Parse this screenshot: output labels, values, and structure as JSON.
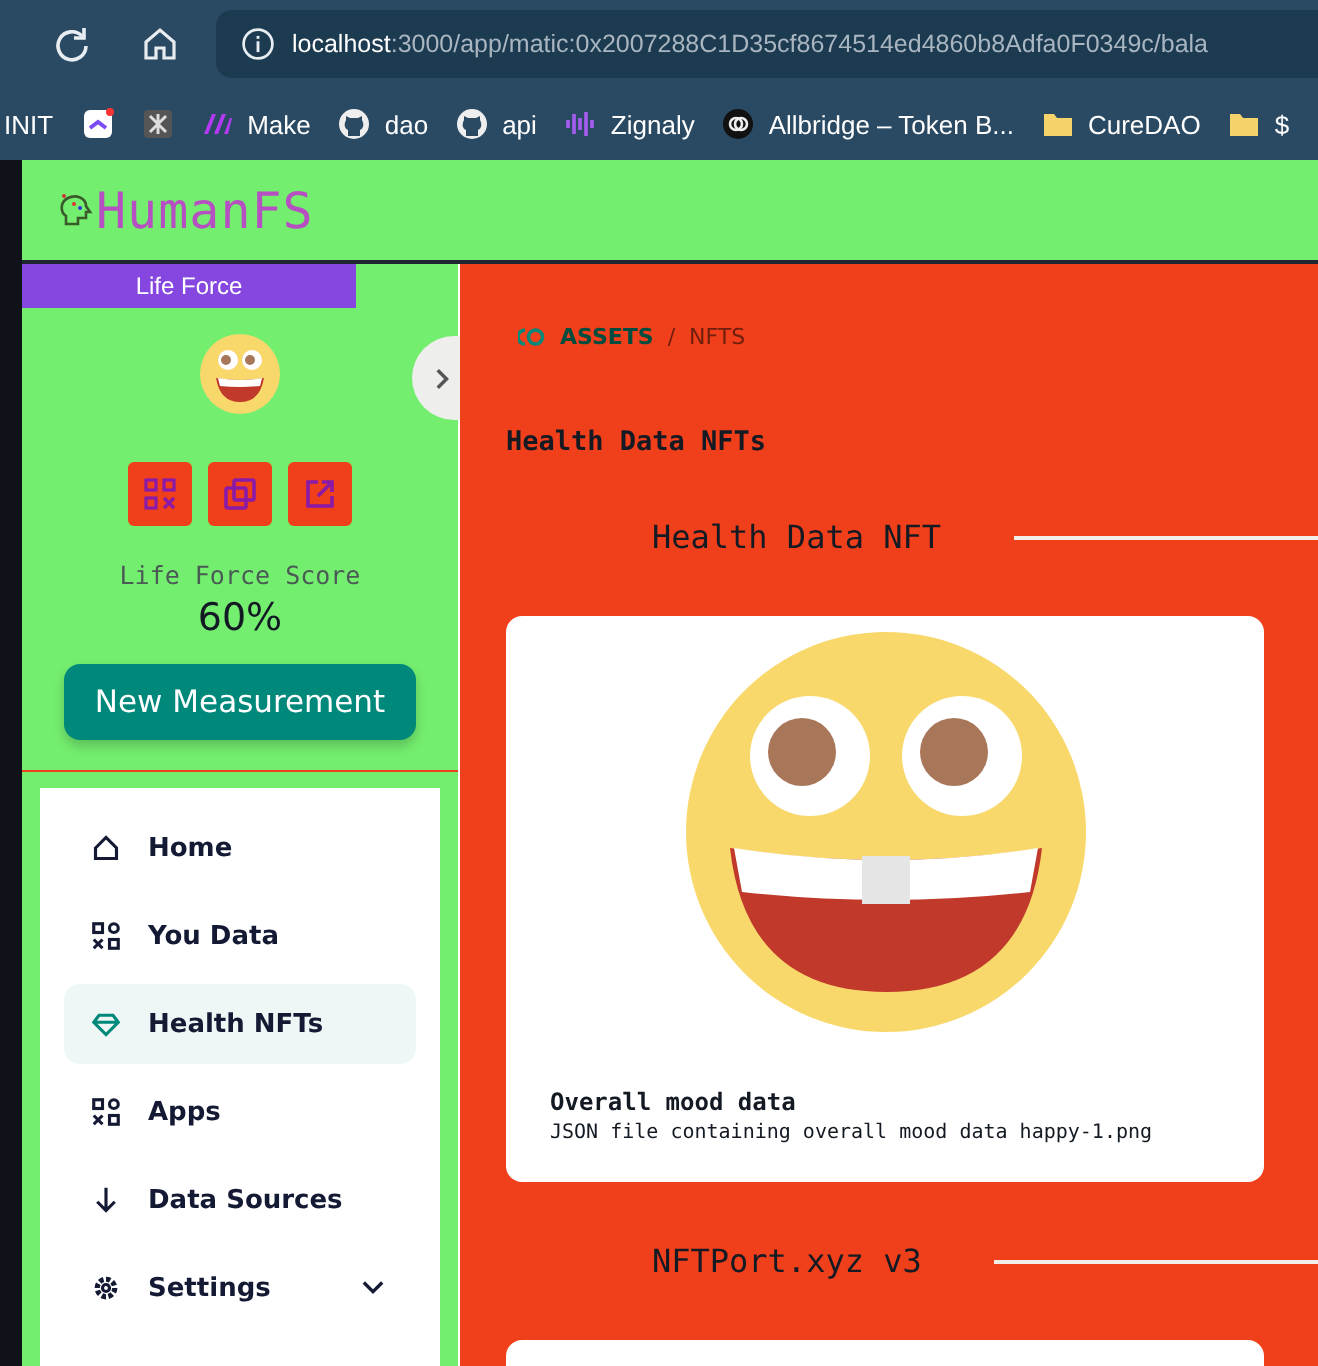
{
  "browser": {
    "url_host": "localhost",
    "url_rest": ":3000/app/matic:0x2007288C1D35cf8674514ed4860b8Adfa0F0349c/bala",
    "bookmarks": [
      {
        "kind": "labeled",
        "label": "INIT"
      },
      {
        "kind": "icon"
      },
      {
        "kind": "icon"
      },
      {
        "kind": "labeled",
        "label": "Make"
      },
      {
        "kind": "labeled",
        "label": "dao"
      },
      {
        "kind": "labeled",
        "label": "api"
      },
      {
        "kind": "labeled",
        "label": "Zignaly"
      },
      {
        "kind": "labeled",
        "label": "Allbridge – Token B..."
      },
      {
        "kind": "labeled",
        "label": "CureDAO"
      },
      {
        "kind": "labeled",
        "label": "$"
      }
    ]
  },
  "app": {
    "logo": "HumanFS"
  },
  "sidebar": {
    "badge": "Life Force",
    "score_label": "Life Force Score",
    "score": "60%",
    "button": "New Measurement",
    "nav": [
      {
        "label": "Home",
        "selected": false
      },
      {
        "label": "You Data",
        "selected": false
      },
      {
        "label": "Health NFTs",
        "selected": true
      },
      {
        "label": "Apps",
        "selected": false
      },
      {
        "label": "Data Sources",
        "selected": false
      },
      {
        "label": "Settings",
        "selected": false
      }
    ]
  },
  "main": {
    "breadcrumb": [
      "ASSETS",
      "/",
      "NFTS"
    ],
    "heading": "Health Data NFTs",
    "sections": [
      {
        "title": "Health Data NFT",
        "cards": [
          {
            "kind": "picture",
            "title": "Overall mood data",
            "description": "JSON file containing overall mood data happy-1.png"
          }
        ]
      },
      {
        "title": "NFTPort.xyz v3",
        "cards": [
          {
            "kind": "blank"
          }
        ]
      }
    ]
  }
}
